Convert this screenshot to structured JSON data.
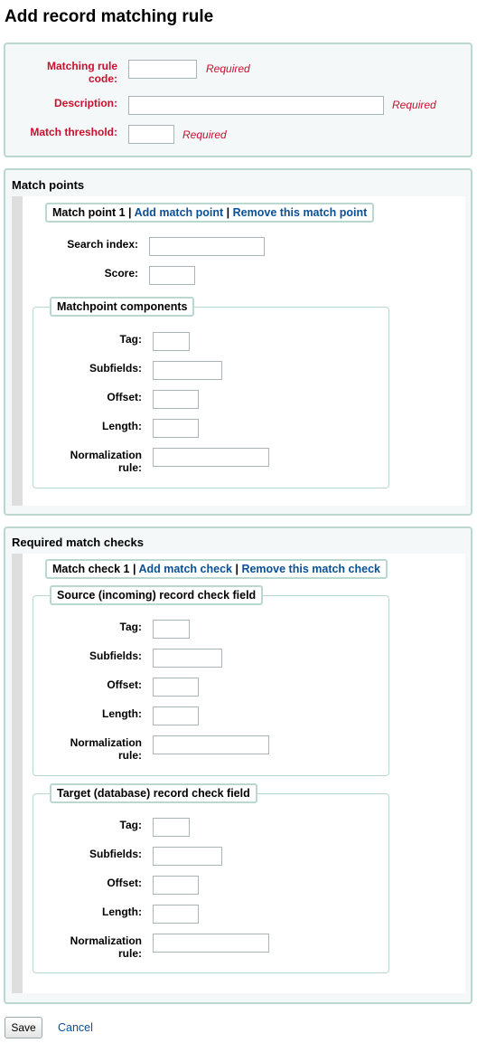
{
  "page": {
    "title": "Add record matching rule"
  },
  "rule": {
    "code_label": "Matching rule code:",
    "description_label": "Description:",
    "threshold_label": "Match threshold:",
    "required_text": "Required"
  },
  "match_points": {
    "title": "Match points",
    "legend_title": "Match point 1",
    "separator": "|",
    "add_link": "Add match point",
    "remove_link": "Remove this match point",
    "search_index_label": "Search index:",
    "score_label": "Score:",
    "components": {
      "legend": "Matchpoint components",
      "tag_label": "Tag:",
      "subfields_label": "Subfields:",
      "offset_label": "Offset:",
      "length_label": "Length:",
      "normalization_label": "Normalization rule:"
    }
  },
  "match_checks": {
    "title": "Required match checks",
    "legend_title": "Match check 1",
    "separator": "|",
    "add_link": "Add match check",
    "remove_link": "Remove this match check",
    "source": {
      "legend": "Source (incoming) record check field",
      "tag_label": "Tag:",
      "subfields_label": "Subfields:",
      "offset_label": "Offset:",
      "length_label": "Length:",
      "normalization_label": "Normalization rule:"
    },
    "target": {
      "legend": "Target (database) record check field",
      "tag_label": "Tag:",
      "subfields_label": "Subfields:",
      "offset_label": "Offset:",
      "length_label": "Length:",
      "normalization_label": "Normalization rule:"
    }
  },
  "actions": {
    "save_label": "Save",
    "cancel_label": "Cancel"
  }
}
